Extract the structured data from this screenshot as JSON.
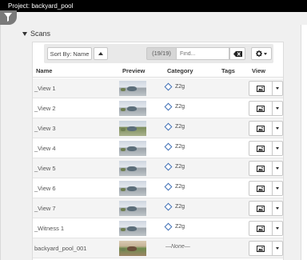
{
  "window": {
    "title": "Project: backyard_pool"
  },
  "section": {
    "title": "Scans"
  },
  "toolbar": {
    "sort_label": "Sort By: Name",
    "count": "(19/19)",
    "find_placeholder": "Find..."
  },
  "table": {
    "columns": {
      "name": "Name",
      "preview": "Preview",
      "category": "Category",
      "tags": "Tags",
      "view": "View"
    },
    "rows": [
      {
        "name": "_View 1",
        "category": "Z2g",
        "thumb": "sky"
      },
      {
        "name": "_View 2",
        "category": "Z2g",
        "thumb": "sky"
      },
      {
        "name": "_View 3",
        "category": "Z2g",
        "thumb": "green"
      },
      {
        "name": "_View 4",
        "category": "Z2g",
        "thumb": "sky"
      },
      {
        "name": "_View 5",
        "category": "Z2g",
        "thumb": "sky"
      },
      {
        "name": "_View 6",
        "category": "Z2g",
        "thumb": "sky"
      },
      {
        "name": "_View 7",
        "category": "Z2g",
        "thumb": "sky"
      },
      {
        "name": "_Witness 1",
        "category": "Z2g",
        "thumb": "sky"
      },
      {
        "name": "backyard_pool_001",
        "category": "—None—",
        "thumb": "warm"
      }
    ]
  },
  "colors": {
    "titlebar": "#000000",
    "category_icon": "#3f6fb5"
  },
  "icons": {
    "filter": "funnel-icon",
    "sort_direction": "triangle-up-icon",
    "clear": "backspace-icon",
    "settings": "gear-icon",
    "view": "image-icon"
  }
}
